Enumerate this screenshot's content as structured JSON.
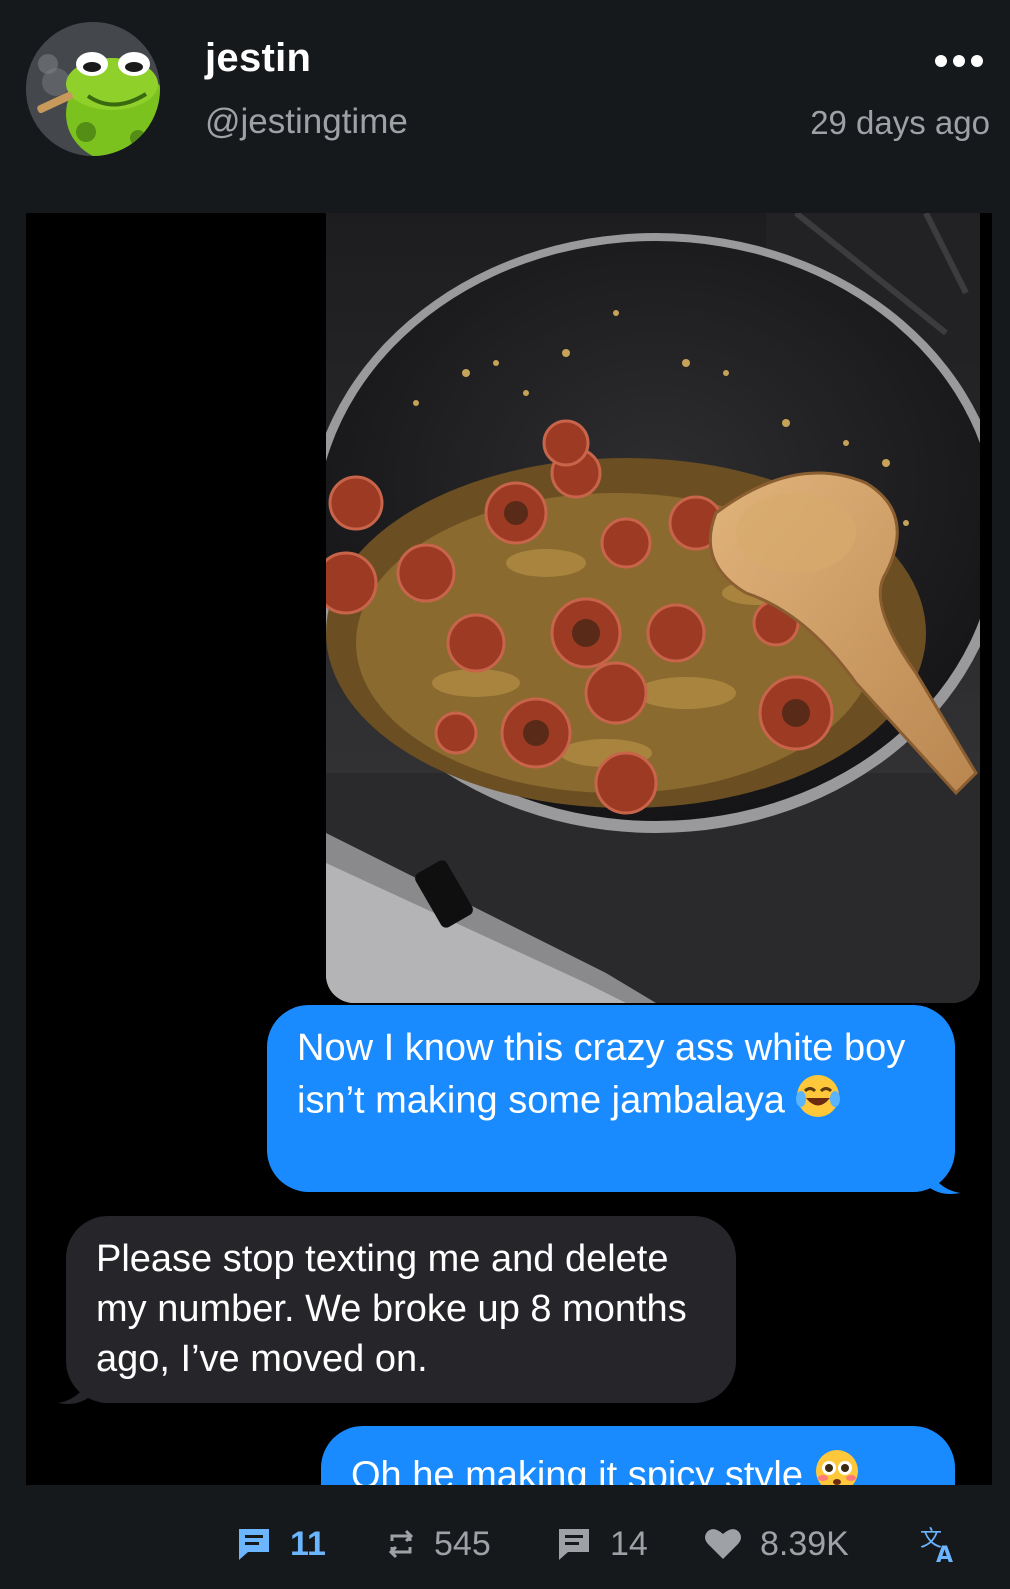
{
  "post": {
    "display_name": "jestin",
    "handle": "@jestingtime",
    "timestamp": "29 days ago",
    "more_icon": "more-horizontal-icon"
  },
  "media": {
    "messages": [
      {
        "from": "me",
        "text": "Now I know this crazy ass white boy isn’t making some jambalaya",
        "emoji": "tears-of-joy-emoji"
      },
      {
        "from": "them",
        "text": "Please stop texting me and delete my number. We broke up 8 months ago, I’ve moved on."
      },
      {
        "from": "me",
        "text": "Oh he making it spicy style",
        "emoji": "flushed-face-emoji"
      }
    ]
  },
  "actions": {
    "comments": "11",
    "reposts": "545",
    "replies": "14",
    "likes": "8.39K"
  },
  "colors": {
    "background": "#15191c",
    "imessage_blue": "#1a8bff",
    "imessage_gray": "#26262a",
    "accent": "#6cb6ff",
    "muted": "#9ea2a6"
  }
}
